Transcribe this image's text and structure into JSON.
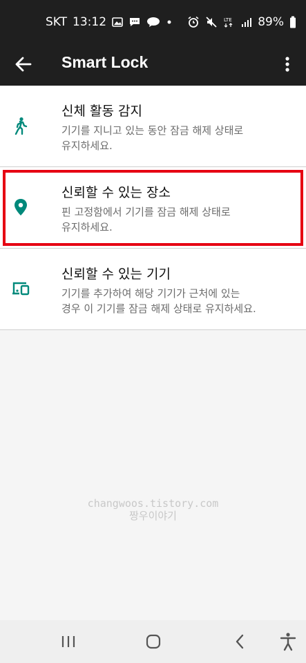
{
  "status_bar": {
    "carrier": "SKT",
    "time": "13:12",
    "battery": "89%"
  },
  "toolbar": {
    "title": "Smart Lock"
  },
  "items": [
    {
      "title": "신체 활동 감지",
      "desc_line1": "기기를 지니고 있는 동안 잠금 해제 상태로",
      "desc_line2": "유지하세요.",
      "icon": "walking-icon"
    },
    {
      "title": "신뢰할 수 있는 장소",
      "desc_line1": "핀 고정함에서 기기를 잠금 해제 상태로",
      "desc_line2": "유지하세요.",
      "icon": "location-pin-icon"
    },
    {
      "title": "신뢰할 수 있는 기기",
      "desc_line1": "기기를 추가하여 해당 기기가 근처에 있는",
      "desc_line2": "경우 이 기기를 잠금 해제 상태로 유지하세요.",
      "icon": "devices-icon"
    }
  ],
  "watermark": {
    "line1": "changwoos.tistory.com",
    "line2": "짱우이야기"
  },
  "colors": {
    "accent_teal": "#00897b",
    "bar_dark": "#1f1f1f",
    "highlight_red": "#e60012"
  }
}
